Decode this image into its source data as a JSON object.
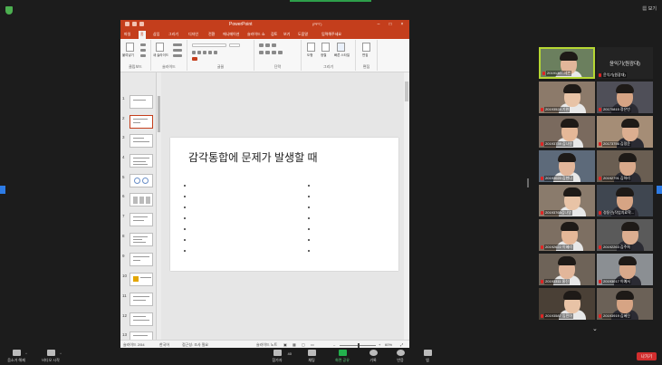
{
  "zoom": {
    "top_right_label": "보기",
    "leave_label": "나가기",
    "toolbar": [
      {
        "label": "음소거 해제",
        "icon": "microphone-muted-icon"
      },
      {
        "label": "비디오 시작",
        "icon": "video-off-icon"
      },
      {
        "label": "참가자",
        "icon": "participants-icon",
        "count": "40"
      },
      {
        "label": "채팅",
        "icon": "chat-icon"
      },
      {
        "label": "화면 공유",
        "icon": "share-screen-icon"
      },
      {
        "label": "기록",
        "icon": "record-icon"
      },
      {
        "label": "반응",
        "icon": "reactions-icon"
      },
      {
        "label": "앱",
        "icon": "apps-icon"
      }
    ],
    "participants": [
      {
        "name": "2019130...세빈",
        "speaker": true
      },
      {
        "name": "윤익기(원광대)",
        "speaker": false,
        "big": "윤익기(원광대)"
      },
      {
        "name": "20193524 기완",
        "speaker": false
      },
      {
        "name": "20170815 정은빈",
        "speaker": false
      },
      {
        "name": "20193739 김나원",
        "speaker": false
      },
      {
        "name": "20173756 김정운",
        "speaker": false
      },
      {
        "name": "20193020 김현나",
        "speaker": false
      },
      {
        "name": "20192791 김하리",
        "speaker": false
      },
      {
        "name": "20193765김나영",
        "speaker": false
      },
      {
        "name": "정동민(작업치료학...",
        "speaker": false
      },
      {
        "name": "20192622 이혜리",
        "speaker": false
      },
      {
        "name": "20192263 김주희",
        "speaker": false
      },
      {
        "name": "20193311 홍진",
        "speaker": false
      },
      {
        "name": "20193017 이예서",
        "speaker": false
      },
      {
        "name": "20193587 임민아",
        "speaker": false
      },
      {
        "name": "20193919 김혜진",
        "speaker": false
      }
    ]
  },
  "powerpoint": {
    "title": "PowerPoint",
    "user": "(PPT)",
    "tabs": [
      "파일",
      "홈",
      "삽입",
      "그리기",
      "디자인",
      "전환",
      "애니메이션",
      "슬라이드 쇼",
      "검토",
      "보기",
      "도움말",
      "입력해주세요"
    ],
    "active_tab": "홈",
    "ribbon_groups": [
      "클립보드",
      "슬라이드",
      "글꼴",
      "단락",
      "그리기",
      "편집"
    ],
    "ribbon_items": {
      "paste": "붙여넣기",
      "new_slide": "새 슬라이드",
      "shapes": "도형",
      "arrange": "정렬",
      "quick_styles": "빠른 스타일",
      "edit": "편집"
    },
    "slide_numbers": [
      "1",
      "2",
      "3",
      "4",
      "5",
      "6",
      "7",
      "8",
      "9",
      "10",
      "11",
      "12",
      "13"
    ],
    "selected_slide": 2,
    "slide_title": "감각통합에 문제가 발생할 때",
    "status": {
      "slide_info": "슬라이드 2/54",
      "language": "한국어",
      "accessibility": "접근성: 조사 필요",
      "notes": "슬라이드 노트",
      "zoom": "60%"
    }
  }
}
